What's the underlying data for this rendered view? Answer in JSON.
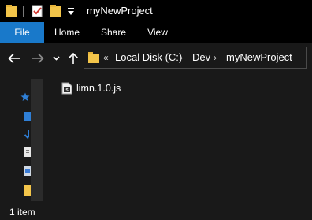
{
  "window": {
    "title": "myNewProject"
  },
  "ribbon": {
    "tabs": [
      {
        "label": "File"
      },
      {
        "label": "Home"
      },
      {
        "label": "Share"
      },
      {
        "label": "View"
      }
    ]
  },
  "address": {
    "overflow": "«",
    "crumbs": [
      "Local Disk (C:)",
      "Dev",
      "myNewProject"
    ]
  },
  "files": [
    {
      "name": "limn.1.0.js",
      "icon": "js-file-icon"
    }
  ],
  "status": {
    "item_count": "1 item"
  },
  "colors": {
    "accent": "#1979ca",
    "folder": "#f3c54a",
    "background": "#191919"
  }
}
